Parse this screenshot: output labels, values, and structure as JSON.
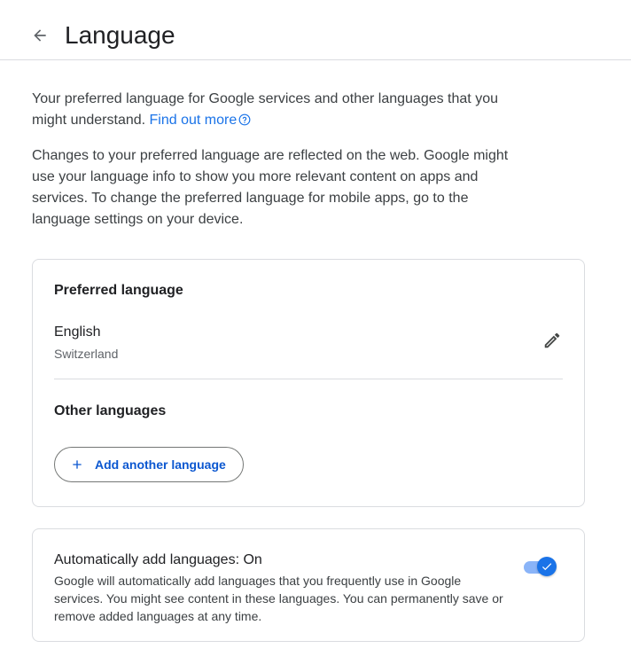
{
  "header": {
    "title": "Language",
    "back_icon": "arrow-back-icon"
  },
  "intro": {
    "text": "Your preferred language for Google services and other languages that you might understand.",
    "link_label": "Find out more",
    "link_icon": "help-icon"
  },
  "description": "Changes to your preferred language are reflected on the web. Google might use your language info to show you more relevant content on apps and services. To change the preferred language for mobile apps, go to the language settings on your device.",
  "preferred": {
    "title": "Preferred language",
    "language": "English",
    "region": "Switzerland",
    "edit_icon": "pencil-icon"
  },
  "other": {
    "title": "Other languages",
    "add_button_label": "Add another language",
    "add_icon": "plus-icon"
  },
  "auto_add": {
    "title": "Automatically add languages: On",
    "description": "Google will automatically add languages that you frequently use in Google services. You might see content in these languages. You can permanently save or remove added languages at any time.",
    "toggle_state": "on"
  },
  "colors": {
    "link": "#1a73e8",
    "button_text": "#0b57d0",
    "toggle_track": "#8ab4f8",
    "toggle_knob": "#1a73e8",
    "border": "#dadce0"
  }
}
